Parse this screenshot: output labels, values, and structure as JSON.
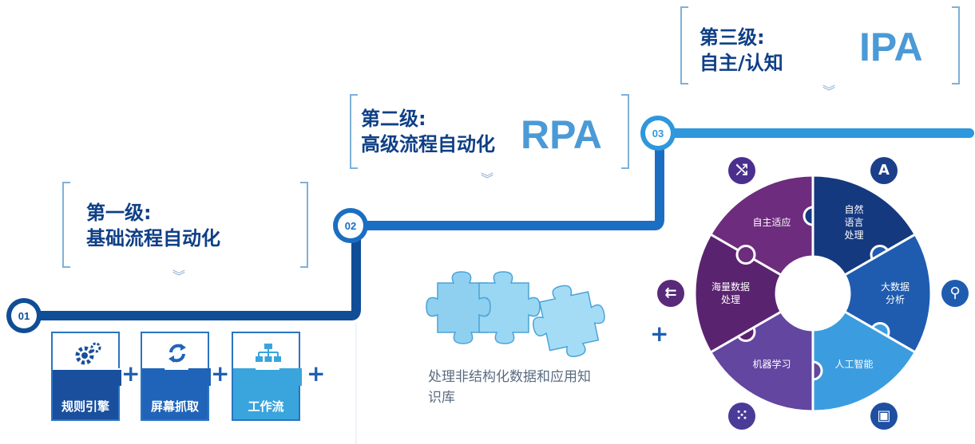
{
  "levels": [
    {
      "title_line1": "第一级:",
      "title_line2": "基础流程自动化",
      "node": "01"
    },
    {
      "title_line1": "第二级:",
      "title_line2": "高级流程自动化",
      "acronym": "RPA",
      "node": "02",
      "caption": "处理非结构化数据和应用知识库"
    },
    {
      "title_line1": "第三级:",
      "title_line2": "自主/认知",
      "acronym": "IPA",
      "node": "03"
    }
  ],
  "chevron": "︾",
  "boxes": [
    {
      "label": "规则引擎",
      "icon": "gears-icon",
      "color": "#1a4f9e"
    },
    {
      "label": "屏幕抓取",
      "icon": "refresh-icon",
      "color": "#1f64b8"
    },
    {
      "label": "工作流",
      "icon": "workflow-icon",
      "color": "#3aa4dc"
    }
  ],
  "plus": "+",
  "caption_lines": [
    "处理非结构化数据和应用知",
    "识库"
  ],
  "wheel_segments": [
    {
      "label_lines": [
        "自主适应"
      ],
      "color": "#6d2c7e"
    },
    {
      "label_lines": [
        "自然",
        "语言",
        "处理"
      ],
      "color": "#15397f"
    },
    {
      "label_lines": [
        "大数据",
        "分析"
      ],
      "color": "#1f5cb0"
    },
    {
      "label_lines": [
        "人工智能"
      ],
      "color": "#3b9de0"
    },
    {
      "label_lines": [
        "机器学习"
      ],
      "color": "#6246a0"
    },
    {
      "label_lines": [
        "海量数据",
        "处理"
      ],
      "color": "#5a236f"
    }
  ],
  "wheel_icons": [
    {
      "name": "shuffle-icon",
      "glyph": "⤭",
      "color": "#4b2f8f"
    },
    {
      "name": "font-a-icon",
      "glyph": "A",
      "color": "#1c3f8a"
    },
    {
      "name": "search-icon",
      "glyph": "⚲",
      "color": "#1f5cb0"
    },
    {
      "name": "chip-icon",
      "glyph": "▣",
      "color": "#1f4fa0"
    },
    {
      "name": "grid-icon",
      "glyph": "⁙",
      "color": "#4a3b98"
    },
    {
      "name": "arrows-icon",
      "glyph": "⇇",
      "color": "#5a2a7a"
    }
  ],
  "colors": {
    "line_dark": "#0f4d96",
    "line_light": "#2f97dc",
    "node_ring": "#1d63b8"
  }
}
